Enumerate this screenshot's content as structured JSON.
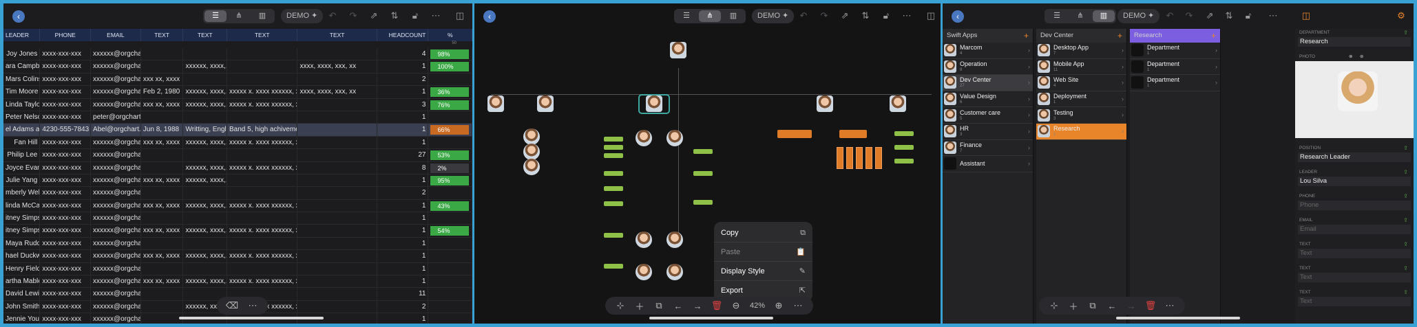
{
  "common": {
    "demo_label": "DEMO"
  },
  "spreadsheet": {
    "columns": [
      "LEADER",
      "PHONE",
      "EMAIL",
      "TEXT",
      "TEXT",
      "TEXT",
      "TEXT",
      "HEADCOUNT",
      "%"
    ],
    "subheader": "50",
    "rows": [
      {
        "name": "Joy Jones",
        "phone": "xxxx-xxx-xxx",
        "email": "xxxxxx@orgchart...",
        "t1": "",
        "t2": "",
        "t3": "",
        "t4": "",
        "hc": "4",
        "pct": "98%",
        "pct_color": "#39a845",
        "sel": false
      },
      {
        "name": "ara Campbell",
        "phone": "xxxx-xxx-xxx",
        "email": "xxxxxx@orgchart...",
        "t1": "",
        "t2": "xxxxxx, xxxx,...",
        "t3": "",
        "t4": "xxxx, xxxx, xxx, xx",
        "hc": "1",
        "pct": "100%",
        "pct_color": "#39a845",
        "sel": false
      },
      {
        "name": "Mars Colins",
        "phone": "xxxx-xxx-xxx",
        "email": "xxxxxx@orgchart...",
        "t1": "xxx xx, xxxx",
        "t2": "",
        "t3": "",
        "t4": "",
        "hc": "2",
        "pct": "",
        "pct_color": "",
        "sel": false
      },
      {
        "name": "Tim Moore",
        "phone": "xxxx-xxx-xxx",
        "email": "xxxxxx@orgchart...",
        "t1": "Feb 2, 1980",
        "t2": "xxxxxx, xxxx,...",
        "t3": "xxxxx x. xxxx xxxxxx, x...",
        "t4": "xxxx, xxxx, xxx, xx",
        "hc": "1",
        "pct": "36%",
        "pct_color": "#39a845",
        "sel": false
      },
      {
        "name": "Linda Taylor",
        "phone": "xxxx-xxx-xxx",
        "email": "xxxxxx@orgchart...",
        "t1": "xxx xx, xxxx",
        "t2": "xxxxxx, xxxx,...",
        "t3": "xxxxx x. xxxx xxxxxx, x...",
        "t4": "",
        "hc": "3",
        "pct": "76%",
        "pct_color": "#39a845",
        "sel": false
      },
      {
        "name": "Peter Nelson",
        "phone": "xxxx-xxx-xxx",
        "email": "peter@orgchart...",
        "t1": "",
        "t2": "",
        "t3": "",
        "t4": "",
        "hc": "1",
        "pct": "",
        "pct_color": "",
        "sel": false
      },
      {
        "name": "el Adams asdf",
        "phone": "4230-555-7843",
        "email": "Abel@orgchart...",
        "t1": "Jun 8, 1988",
        "t2": "Writting, Engl...",
        "t3": "Band 5, high achivement",
        "t4": "",
        "hc": "1",
        "pct": "66%",
        "pct_color": "#c96a22",
        "sel": true
      },
      {
        "name": "Fan Hill",
        "phone": "xxxx-xxx-xxx",
        "email": "xxxxxx@orgchart...",
        "t1": "xxx xx, xxxx",
        "t2": "xxxxxx, xxxx,...",
        "t3": "xxxxx x. xxxx xxxxxx, x...",
        "t4": "",
        "hc": "1",
        "pct": "",
        "pct_color": "",
        "sel": false
      },
      {
        "name": "Philip Lee",
        "phone": "xxxx-xxx-xxx",
        "email": "xxxxxx@orgchart...",
        "t1": "",
        "t2": "",
        "t3": "",
        "t4": "",
        "hc": "27",
        "pct": "53%",
        "pct_color": "#39a845",
        "sel": false
      },
      {
        "name": "Joyce Evans",
        "phone": "xxxx-xxx-xxx",
        "email": "xxxxxx@orgchart...",
        "t1": "",
        "t2": "xxxxxx, xxxx,...",
        "t3": "xxxxx x. xxxx xxxxxx, x...",
        "t4": "",
        "hc": "8",
        "pct": "2%",
        "pct_color": "#3a3a3e",
        "sel": false
      },
      {
        "name": "Julie Yang",
        "phone": "xxxx-xxx-xxx",
        "email": "xxxxxx@orgchart...",
        "t1": "xxx xx, xxxx",
        "t2": "xxxxxx, xxxx,...",
        "t3": "",
        "t4": "",
        "hc": "1",
        "pct": "95%",
        "pct_color": "#39a845",
        "sel": false
      },
      {
        "name": "mberly Weber",
        "phone": "xxxx-xxx-xxx",
        "email": "xxxxxx@orgchart...",
        "t1": "",
        "t2": "",
        "t3": "",
        "t4": "",
        "hc": "2",
        "pct": "",
        "pct_color": "",
        "sel": false
      },
      {
        "name": "linda McCarthy",
        "phone": "xxxx-xxx-xxx",
        "email": "xxxxxx@orgchart...",
        "t1": "xxx xx, xxxx",
        "t2": "xxxxxx, xxxx,...",
        "t3": "xxxxx x. xxxx xxxxxx, x...",
        "t4": "",
        "hc": "1",
        "pct": "43%",
        "pct_color": "#39a845",
        "sel": false
      },
      {
        "name": "itney Simpson",
        "phone": "xxxx-xxx-xxx",
        "email": "xxxxxx@orgchart...",
        "t1": "",
        "t2": "",
        "t3": "",
        "t4": "",
        "hc": "1",
        "pct": "",
        "pct_color": "",
        "sel": false
      },
      {
        "name": "itney Simpson",
        "phone": "xxxx-xxx-xxx",
        "email": "xxxxxx@orgchart...",
        "t1": "xxx xx, xxxx",
        "t2": "xxxxxx, xxxx,...",
        "t3": "xxxxx x. xxxx xxxxxx, x...",
        "t4": "",
        "hc": "1",
        "pct": "54%",
        "pct_color": "#39a845",
        "sel": false
      },
      {
        "name": "Maya Ruddy",
        "phone": "xxxx-xxx-xxx",
        "email": "xxxxxx@orgchart...",
        "t1": "",
        "t2": "",
        "t3": "",
        "t4": "",
        "hc": "1",
        "pct": "",
        "pct_color": "",
        "sel": false
      },
      {
        "name": "hael Duckworth",
        "phone": "xxxx-xxx-xxx",
        "email": "xxxxxx@orgchart...",
        "t1": "xxx xx, xxxx",
        "t2": "xxxxxx, xxxx,...",
        "t3": "xxxxx x. xxxx xxxxxx, x...",
        "t4": "",
        "hc": "1",
        "pct": "",
        "pct_color": "",
        "sel": false
      },
      {
        "name": "Henry Fields",
        "phone": "xxxx-xxx-xxx",
        "email": "xxxxxx@orgchart...",
        "t1": "",
        "t2": "",
        "t3": "",
        "t4": "",
        "hc": "1",
        "pct": "",
        "pct_color": "",
        "sel": false
      },
      {
        "name": "artha Mables",
        "phone": "xxxx-xxx-xxx",
        "email": "xxxxxx@orgchart...",
        "t1": "xxx xx, xxxx",
        "t2": "xxxxxx, xxxx,...",
        "t3": "xxxxx x. xxxx xxxxxx, x...",
        "t4": "",
        "hc": "1",
        "pct": "",
        "pct_color": "",
        "sel": false
      },
      {
        "name": "David Lewis",
        "phone": "xxxx-xxx-xxx",
        "email": "xxxxxx@orgchart...",
        "t1": "",
        "t2": "",
        "t3": "",
        "t4": "",
        "hc": "11",
        "pct": "",
        "pct_color": "",
        "sel": false
      },
      {
        "name": "John Smith",
        "phone": "xxxx-xxx-xxx",
        "email": "xxxxxx@orgchart...",
        "t1": "",
        "t2": "xxxxxx, xxxx,...",
        "t3": "xxxxx x. xxxx xxxxxx, x...",
        "t4": "",
        "hc": "2",
        "pct": "",
        "pct_color": "",
        "sel": false
      },
      {
        "name": "Jennie Young",
        "phone": "xxxx-xxx-xxx",
        "email": "xxxxxx@orgchart...",
        "t1": "",
        "t2": "",
        "t3": "",
        "t4": "",
        "hc": "1",
        "pct": "",
        "pct_color": "",
        "sel": false
      }
    ]
  },
  "orgchart": {
    "context_menu": [
      {
        "label": "Copy",
        "icon": "copy-icon",
        "glyph": "⧉",
        "disabled": false
      },
      {
        "label": "Paste",
        "icon": "paste-icon",
        "glyph": "📋",
        "disabled": true
      },
      {
        "label": "Display Style",
        "icon": "brush-icon",
        "glyph": "✎",
        "disabled": false
      },
      {
        "label": "Export",
        "icon": "export-icon",
        "glyph": "⇱",
        "disabled": false
      }
    ],
    "zoom": "42%"
  },
  "columns_view": {
    "col1": {
      "title": "Swift Apps",
      "items": [
        {
          "name": "Marcom",
          "count": "4",
          "state": ""
        },
        {
          "name": "Operation",
          "count": "9",
          "state": ""
        },
        {
          "name": "Dev Center",
          "count": "27",
          "state": "hi"
        },
        {
          "name": "Value Design",
          "count": "6",
          "state": ""
        },
        {
          "name": "Customer care",
          "count": "5",
          "state": ""
        },
        {
          "name": "HR",
          "count": "3",
          "state": ""
        },
        {
          "name": "Finance",
          "count": "7",
          "state": ""
        },
        {
          "name": "Assistant",
          "count": "",
          "state": "blank"
        }
      ]
    },
    "col2": {
      "title": "Dev Center",
      "items": [
        {
          "name": "Desktop App",
          "count": "7",
          "state": ""
        },
        {
          "name": "Mobile App",
          "count": "11",
          "state": ""
        },
        {
          "name": "Web Site",
          "count": "4",
          "state": ""
        },
        {
          "name": "Deployment",
          "count": "1",
          "state": ""
        },
        {
          "name": "Testing",
          "count": "3",
          "state": ""
        },
        {
          "name": "Research",
          "count": "1",
          "state": "org"
        }
      ]
    },
    "col3": {
      "title": "Research",
      "items": [
        {
          "name": "Department",
          "count": "1",
          "state": "blank"
        },
        {
          "name": "Department",
          "count": "1",
          "state": "blank"
        },
        {
          "name": "Department",
          "count": "1",
          "state": "blank"
        }
      ]
    },
    "accent": "#7b5fe0"
  },
  "inspector": {
    "department_label": "DEPARTMENT",
    "department_value": "Research",
    "photo_label": "PHOTO",
    "position_label": "POSITION",
    "position_value": "Research Leader",
    "leader_label": "LEADER",
    "leader_value": "Lou Silva",
    "phone_label": "PHONE",
    "phone_placeholder": "Phone",
    "email_label": "EMAIL",
    "email_placeholder": "Email",
    "text_label": "TEXT",
    "text_placeholder": "Text"
  }
}
